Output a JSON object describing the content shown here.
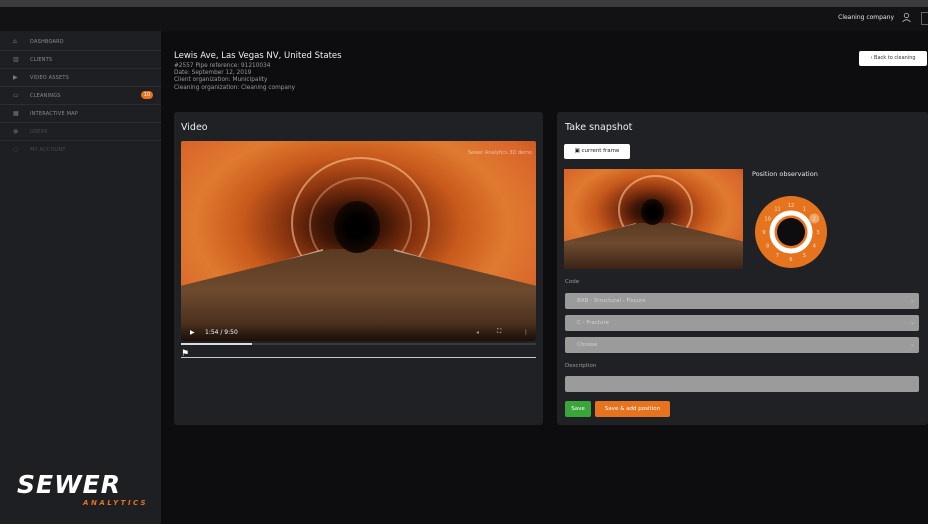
{
  "topbar": {
    "company": "Cleaning company",
    "user_icon": "user-icon",
    "logout_icon": "logout-icon"
  },
  "sidebar": {
    "items": [
      {
        "label": "Dashboard",
        "icon": "home-icon"
      },
      {
        "label": "Clients",
        "icon": "building-icon"
      },
      {
        "label": "Video assets",
        "icon": "video-icon"
      },
      {
        "label": "Cleanings",
        "icon": "folder-icon",
        "badge": "10"
      },
      {
        "label": "Interactive map",
        "icon": "map-icon"
      },
      {
        "label": "Users",
        "icon": "user-icon"
      },
      {
        "label": "My account",
        "icon": "account-icon"
      }
    ],
    "logo": {
      "line1": "SEWER",
      "line2": "ANALYTICS"
    }
  },
  "header": {
    "title": "Lewis Ave, Las Vegas NV, United States",
    "pipe_ref": "#2557 Pipe reference: 91210034",
    "date": "Date: September 12, 2019",
    "client_org": "Client organization: Municipality",
    "cleaning_org": "Cleaning organization: Cleaning company",
    "back_button": "‹ Back to cleaning"
  },
  "video_card": {
    "title": "Video",
    "watermark": "Sewer Analytics 3D demo",
    "time": "1:54 / 9:50",
    "progress": 0.2
  },
  "snapshot_card": {
    "title": "Take snapshot",
    "current_frame_button": "current frame",
    "position_label": "Position observation",
    "code_label": "Code",
    "code_value": "BAB - Structural - Fissure",
    "code2_value": "C - Fracture",
    "code3_value": "Choose",
    "description_label": "Description",
    "save_button": "Save",
    "save_add_button": "Save & add position",
    "dial_numbers": [
      "12",
      "1",
      "2",
      "3",
      "4",
      "5",
      "6",
      "7",
      "8",
      "9",
      "10",
      "11"
    ],
    "dial_selected": "2",
    "colors": {
      "accent": "#e6731e",
      "save": "#3aa53a"
    }
  }
}
